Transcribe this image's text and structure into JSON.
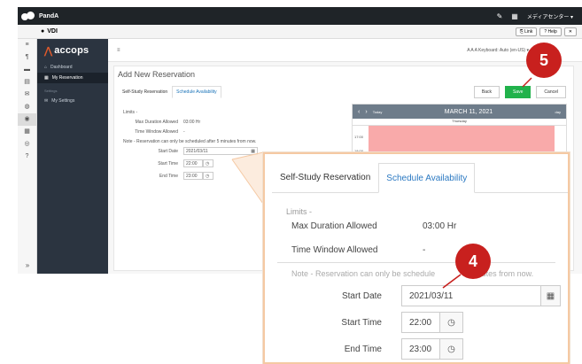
{
  "app": {
    "name": "PandA",
    "vdi": "VDI",
    "top_right": "メディアセンター ▾"
  },
  "toolbar": {
    "link_label": "Link",
    "help_label": "Help"
  },
  "iconcol": [
    "≡",
    "¶",
    "▬",
    "▤",
    "✉",
    "◍",
    "◉",
    "▦",
    "◎",
    "?"
  ],
  "sidebar": {
    "brand": "accops",
    "items": [
      {
        "icon": "⌂",
        "label": "Dashboard"
      },
      {
        "icon": "▦",
        "label": "My Reservation"
      }
    ],
    "caption": "Settings",
    "settings_item": {
      "icon": "✉",
      "label": "My Settings"
    }
  },
  "main": {
    "menu_glyph": "≡",
    "keyboard": "A  A  A   Keyboard: Auto (en-US) ▾",
    "title": "Add New Reservation",
    "tabs": [
      "Self-Study Reservation",
      "Schedule Availability"
    ],
    "buttons": {
      "back": "Back",
      "save": "Save",
      "cancel": "Cancel"
    },
    "limits": "Limits -",
    "max_duration_label": "Max Duration Allowed",
    "max_duration_value": "03:00 Hr",
    "time_window_label": "Time Window Allowed",
    "time_window_value": "-",
    "note": "Note - Reservation can only be scheduled after 5 minutes from now.",
    "start_date_label": "Start Date",
    "start_date_value": "2021/03/11",
    "start_time_label": "Start Time",
    "start_time_value": "22:00",
    "end_time_label": "End Time",
    "end_time_value": "23:00"
  },
  "calendar": {
    "title": "MARCH 11, 2021",
    "today": "Today",
    "day": "Thursday",
    "times": [
      "17:00",
      "18:00"
    ]
  },
  "zoom": {
    "tabs": [
      "Self-Study Reservation",
      "Schedule Availability"
    ],
    "limits": "Limits -",
    "max_duration_label": "Max Duration Allowed",
    "max_duration_value": "03:00 Hr",
    "time_window_label": "Time Window Allowed",
    "time_window_value": "-",
    "note": "Note - Reservation can only be schedule",
    "note_tail": "minutes from now.",
    "start_date_label": "Start Date",
    "start_date_value": "2021/03/11",
    "start_time_label": "Start Time",
    "start_time_value": "22:00",
    "end_time_label": "End Time",
    "end_time_value": "23:00"
  },
  "callouts": {
    "save_step": "5",
    "form_step": "4"
  },
  "colors": {
    "accent": "#2b79c2",
    "save_green": "#21b24b",
    "callout_red": "#c8201e",
    "zoom_border": "#f5c9a3"
  }
}
